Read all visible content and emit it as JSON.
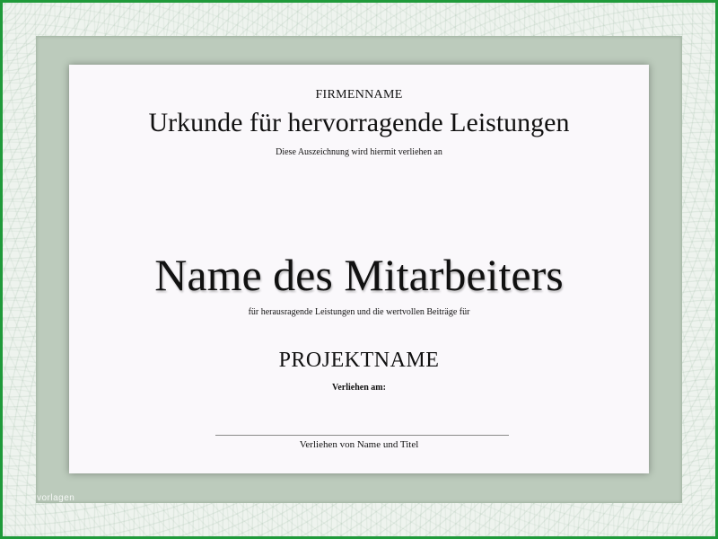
{
  "certificate": {
    "company_name": "FIRMENNAME",
    "award_title": "Urkunde für hervorragende Leistungen",
    "presented_line": "Diese Auszeichnung wird hiermit verliehen an",
    "employee_name": "Name des Mitarbeiters",
    "reason_line": "für herausragende Leistungen und die wertvollen Beiträge für",
    "project_name": "PROJEKTNAME",
    "date_label": "Verliehen am:",
    "signer_label": "Verliehen von Name und Titel"
  },
  "watermark": "vorlagen",
  "colors": {
    "outer_border": "#1f9a3a",
    "mat": "#bccbbc",
    "paper": "#faf8fb",
    "text": "#111111"
  }
}
